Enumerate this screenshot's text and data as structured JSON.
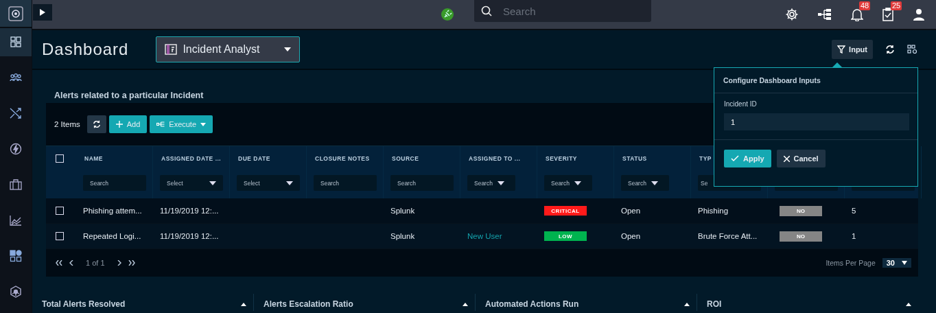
{
  "top_bar": {
    "search": {
      "placeholder": "Search"
    },
    "notifications_badge": "48",
    "tasks_badge": "25"
  },
  "sidebar": {
    "items": [
      {
        "kind": "dashboard",
        "selected": true
      },
      {
        "kind": "people",
        "selected": false
      },
      {
        "kind": "shuffle",
        "selected": false
      },
      {
        "kind": "bolt",
        "selected": false
      },
      {
        "kind": "briefcase",
        "selected": false
      },
      {
        "kind": "chart",
        "selected": false
      },
      {
        "kind": "apps",
        "selected": false
      },
      {
        "kind": "hub",
        "selected": false
      }
    ]
  },
  "header": {
    "title": "Dashboard",
    "dashboard_select": "Incident Analyst",
    "input_button": "Input"
  },
  "widget": {
    "title": "Alerts related to a particular Incident",
    "select_all_checked": false,
    "items_count": "2 Items",
    "add_button": "Add",
    "execute_button": "Execute",
    "columns": [
      {
        "label": "NAME",
        "filter": {
          "kind": "text",
          "placeholder": "Search"
        }
      },
      {
        "label": "ASSIGNED DATE ...",
        "filter": {
          "kind": "select",
          "placeholder": "Select"
        }
      },
      {
        "label": "DUE DATE",
        "filter": {
          "kind": "select",
          "placeholder": "Select"
        }
      },
      {
        "label": "CLOSURE NOTES",
        "filter": {
          "kind": "text",
          "placeholder": "Search"
        }
      },
      {
        "label": "SOURCE",
        "filter": {
          "kind": "text",
          "placeholder": "Search"
        }
      },
      {
        "label": "ASSIGNED TO ...",
        "filter": {
          "kind": "dropdown",
          "placeholder": "Search"
        }
      },
      {
        "label": "SEVERITY",
        "filter": {
          "kind": "dropdown",
          "placeholder": "Search"
        }
      },
      {
        "label": "STATUS",
        "filter": {
          "kind": "dropdown",
          "placeholder": "Search"
        }
      },
      {
        "label": "TYP",
        "filter": {
          "kind": "text",
          "placeholder": "Se"
        }
      },
      {
        "filter": {
          "kind": "blank"
        }
      },
      {
        "filter": {
          "kind": "blank"
        }
      }
    ],
    "rows": [
      {
        "checked": false,
        "cells": [
          {
            "kind": "text",
            "text": "Phishing attem..."
          },
          {
            "kind": "text",
            "text": "11/19/2019 12:..."
          },
          {
            "kind": "empty"
          },
          {
            "kind": "empty"
          },
          {
            "kind": "text",
            "text": "Splunk"
          },
          {
            "kind": "empty"
          },
          {
            "kind": "badge",
            "text": "CRITICAL",
            "color": "#ff1a1a"
          },
          {
            "kind": "text",
            "text": "Open"
          },
          {
            "kind": "text",
            "text": "Phishing"
          },
          {
            "kind": "pill",
            "text": "NO"
          },
          {
            "kind": "text",
            "text": "5"
          }
        ]
      },
      {
        "checked": false,
        "cells": [
          {
            "kind": "text",
            "text": "Repeated Logi..."
          },
          {
            "kind": "text",
            "text": "11/19/2019 12:..."
          },
          {
            "kind": "empty"
          },
          {
            "kind": "empty"
          },
          {
            "kind": "text",
            "text": "Splunk"
          },
          {
            "kind": "link",
            "text": "New User"
          },
          {
            "kind": "badge",
            "text": "LOW",
            "color": "#00b34f"
          },
          {
            "kind": "text",
            "text": "Open"
          },
          {
            "kind": "text",
            "text": "Brute Force Att..."
          },
          {
            "kind": "pill",
            "text": "NO"
          },
          {
            "kind": "text",
            "text": "1"
          }
        ]
      }
    ],
    "pagination": "1 of 1",
    "items_per_page_label": "Items Per Page",
    "items_per_page": "30"
  },
  "popup": {
    "title": "Configure Dashboard Inputs",
    "field_label": "Incident ID",
    "field_value": "1",
    "apply_button": "Apply",
    "cancel_button": "Cancel"
  },
  "bottom_panels": [
    {
      "title": "Total Alerts Resolved"
    },
    {
      "title": "Alerts Escalation Ratio"
    },
    {
      "title": "Automated Actions Run"
    },
    {
      "title": "ROI"
    }
  ]
}
